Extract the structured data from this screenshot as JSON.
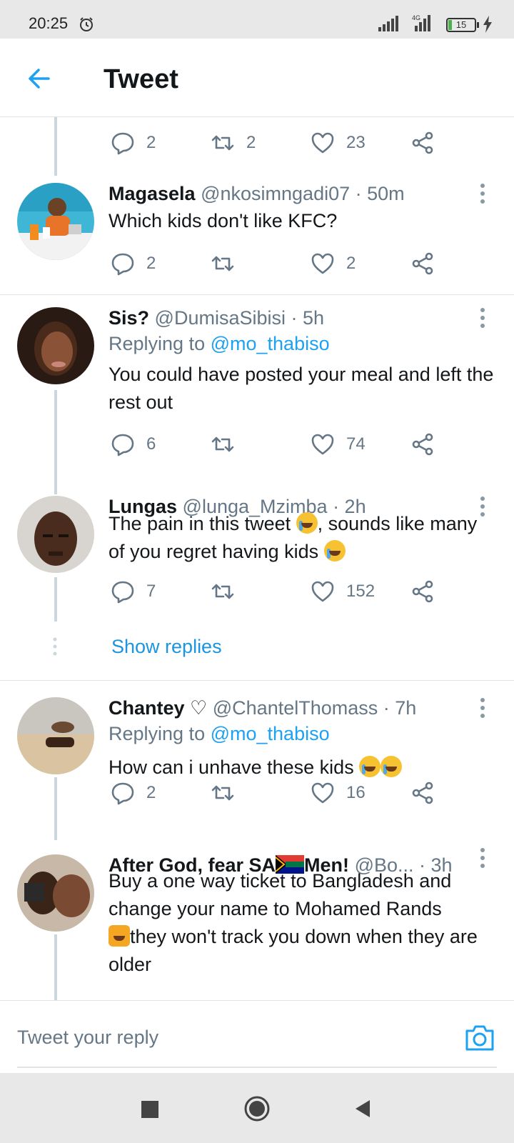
{
  "status_bar": {
    "time": "20:25",
    "network": "4G",
    "battery": "15",
    "icons": [
      "alarm-icon",
      "signal-icon",
      "signal-4g-icon",
      "battery-icon",
      "charging-icon"
    ]
  },
  "header": {
    "title": "Tweet",
    "back_icon": "arrow-left-icon"
  },
  "top_actions": {
    "replies": "2",
    "retweets": "2",
    "likes": "23"
  },
  "tweets": [
    {
      "name": "Magasela",
      "handle": "@nkosimngadi07",
      "time": "· 50m",
      "body": "Which kids don't like KFC?",
      "replies": "2",
      "retweets": "",
      "likes": "2"
    },
    {
      "name": "Sis?",
      "handle": "@DumisaSibisi",
      "time": "· 5h",
      "replying_label": "Replying to",
      "replying_to": "@mo_thabiso",
      "body": "You could have posted your meal and left the rest out",
      "replies": "6",
      "retweets": "",
      "likes": "74"
    },
    {
      "name": "Lungas",
      "handle": "@lunga_Mzimba",
      "time": "· 2h",
      "body_parts": [
        "The pain in this tweet ",
        ", sounds like many of you regret having kids "
      ],
      "replies": "7",
      "retweets": "",
      "likes": "152",
      "show_replies": "Show replies"
    },
    {
      "name": "Chantey ♡",
      "handle": "@ChantelThomass",
      "time": "· 7h",
      "replying_label": "Replying to",
      "replying_to": "@mo_thabiso",
      "body": "How can i unhave these kids ",
      "replies": "2",
      "retweets": "",
      "likes": "16"
    },
    {
      "name_parts": [
        "After God, fear SA",
        "Men!"
      ],
      "handle": "@Bo...",
      "time": "· 3h",
      "body_line1": "Buy a one way ticket to Bangladesh and change your name to Mohamed Rands",
      "body_line2": "they won't track you down when they are older"
    }
  ],
  "reply_box": {
    "placeholder": "Tweet your reply",
    "camera_icon": "camera-icon"
  },
  "nav": {
    "icons": [
      "recents-square-icon",
      "home-circle-icon",
      "back-triangle-icon"
    ]
  },
  "colors": {
    "accent": "#1da1f2",
    "muted": "#657786",
    "text": "#14171a",
    "divider": "#dfe3e7"
  }
}
